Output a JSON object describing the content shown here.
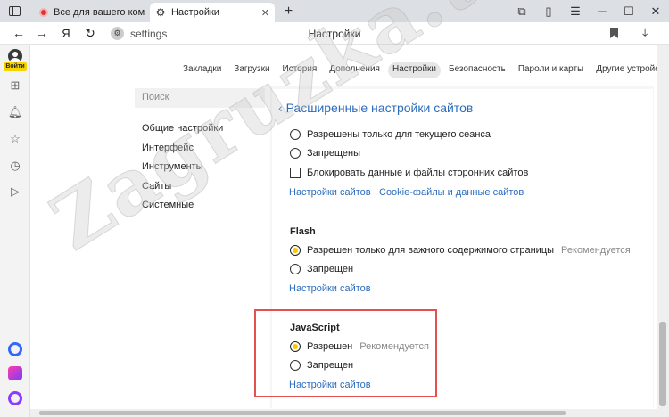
{
  "tabbar": {
    "tabs": [
      {
        "label": "Все для вашего компьюте",
        "active": false
      },
      {
        "label": "Настройки",
        "active": true
      }
    ],
    "new_tab_label": "+"
  },
  "addressbar": {
    "yandex_button": "Я",
    "url": "settings",
    "page_title": "Настройки"
  },
  "sidebar": {
    "login_label": "Войти"
  },
  "settings_nav": {
    "tabs": [
      "Закладки",
      "Загрузки",
      "История",
      "Дополнения",
      "Настройки",
      "Безопасность",
      "Пароли и карты",
      "Другие устройства"
    ],
    "active": "Настройки"
  },
  "settings_menu": {
    "search_placeholder": "Поиск",
    "items": [
      "Общие настройки",
      "Интерфейс",
      "Инструменты",
      "Сайты",
      "Системные"
    ]
  },
  "content": {
    "back_title": "Расширенные настройки сайтов",
    "cookies": {
      "options": [
        {
          "label": "Разрешены только для текущего сеанса",
          "selected": false
        },
        {
          "label": "Запрещены",
          "selected": false
        }
      ],
      "checkbox_label": "Блокировать данные и файлы сторонних сайтов",
      "links": [
        "Настройки сайтов",
        "Cookie-файлы и данные сайтов"
      ]
    },
    "flash": {
      "title": "Flash",
      "options": [
        {
          "label": "Разрешен только для важного содержимого страницы",
          "hint": "Рекомендуется",
          "selected": true
        },
        {
          "label": "Запрещен",
          "selected": false
        }
      ],
      "link": "Настройки сайтов"
    },
    "javascript": {
      "title": "JavaScript",
      "options": [
        {
          "label": "Разрешен",
          "hint": "Рекомендуется",
          "selected": true
        },
        {
          "label": "Запрещен",
          "selected": false
        }
      ],
      "link": "Настройки сайтов"
    }
  },
  "watermark": "Zagruzka.top",
  "colors": {
    "accent_link": "#2c6cbe",
    "radio_selected": "#f7c900",
    "highlight_border": "#e35050",
    "login_badge": "#f7d400"
  }
}
